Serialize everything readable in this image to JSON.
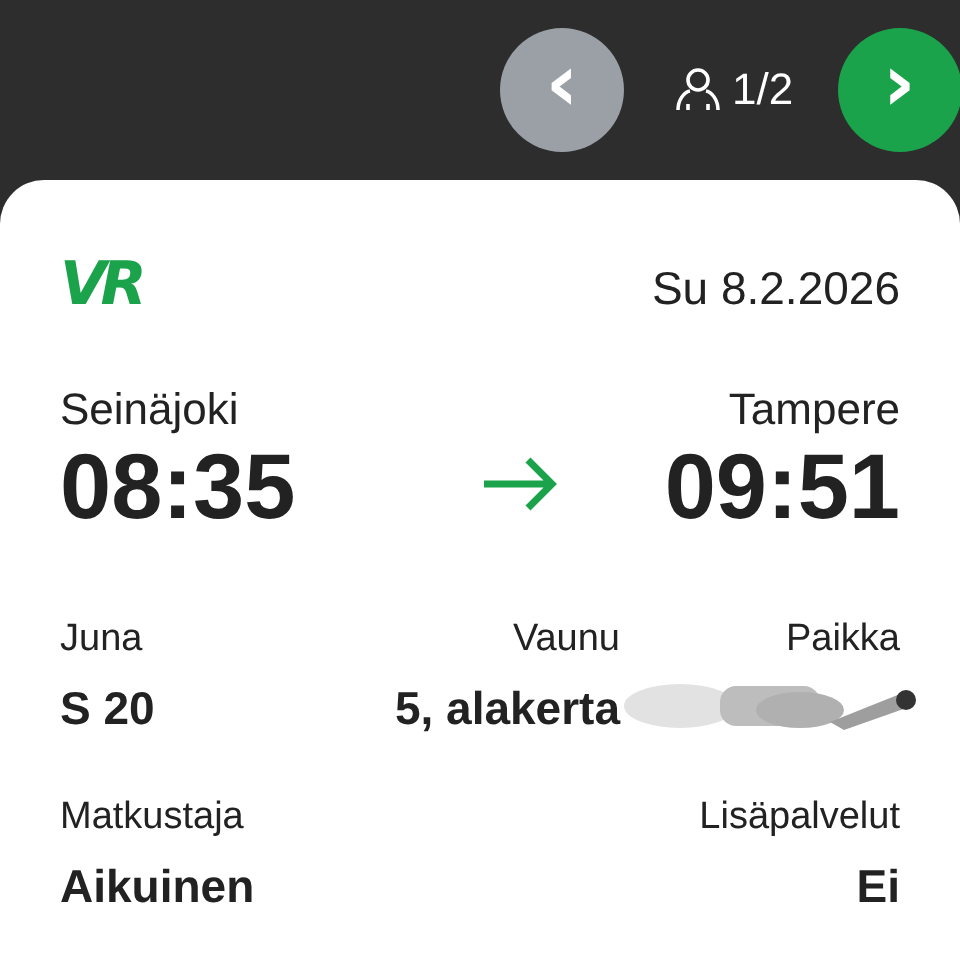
{
  "top_bar": {
    "prev_button": {
      "label": "‹",
      "disabled": true
    },
    "passenger_counter": "1/2",
    "next_button": {
      "label": "›",
      "disabled": false
    }
  },
  "ticket": {
    "logo": "VR",
    "date": "Su 8.2.2026",
    "departure": {
      "station": "Seinäjoki",
      "time": "08:35"
    },
    "arrival": {
      "station": "Tampere",
      "time": "09:51"
    },
    "details": [
      {
        "label": "Juna",
        "value": "S 20",
        "kind": "text"
      },
      {
        "label": "Vaunu",
        "value": "5, alakerta",
        "kind": "text"
      },
      {
        "label": "Paikka",
        "kind": "redacted"
      }
    ],
    "extras": [
      {
        "label": "Matkustaja",
        "value": "Aikuinen"
      },
      {
        "label": "Lisäpalvelut",
        "value": "Ei"
      }
    ]
  }
}
